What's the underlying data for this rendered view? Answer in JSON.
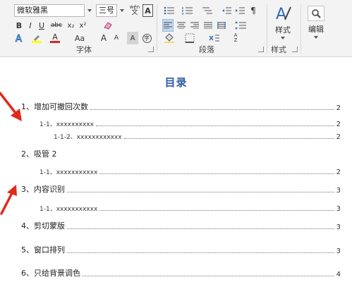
{
  "ribbon": {
    "font_name": "微软雅黑",
    "font_size": "三号",
    "wen_label": "wén",
    "A_box": "A",
    "bold": "B",
    "italic": "I",
    "underline": "U",
    "strike": "abc",
    "subscript": "x₂",
    "superscript": "x²",
    "font_grow": "A",
    "font_shrink": "A",
    "change_case": "Aa",
    "char_border": "字",
    "group_font": "字体",
    "group_paragraph": "段落",
    "group_styles": "样式",
    "styles_button": "样式",
    "edit_button": "编辑",
    "colors": {
      "highlight": "#ffff00",
      "font_color": "#e02020",
      "accent": "#2e5aa3"
    }
  },
  "doc": {
    "toc_title": "目录",
    "entries": [
      {
        "text": "1、增加可撤回次数",
        "page": "2"
      },
      {
        "text": "1-1、xxxxxxxxxx",
        "page": "2"
      },
      {
        "text": "1-1-2、xxxxxxxxxxxx",
        "page": "2"
      },
      {
        "text": "2、吸管  2",
        "page": ""
      },
      {
        "text": "1-1、xxxxxxxxxxx",
        "page": "2"
      },
      {
        "text": "3、内容识别",
        "page": "3"
      },
      {
        "text": "1-1、xxxxxxxxxxx",
        "page": "3"
      },
      {
        "text": "4、剪切蒙版",
        "page": "3"
      },
      {
        "text": "5、窗口排列",
        "page": "3"
      },
      {
        "text": "6、只给背景调色",
        "page": "4"
      }
    ]
  }
}
